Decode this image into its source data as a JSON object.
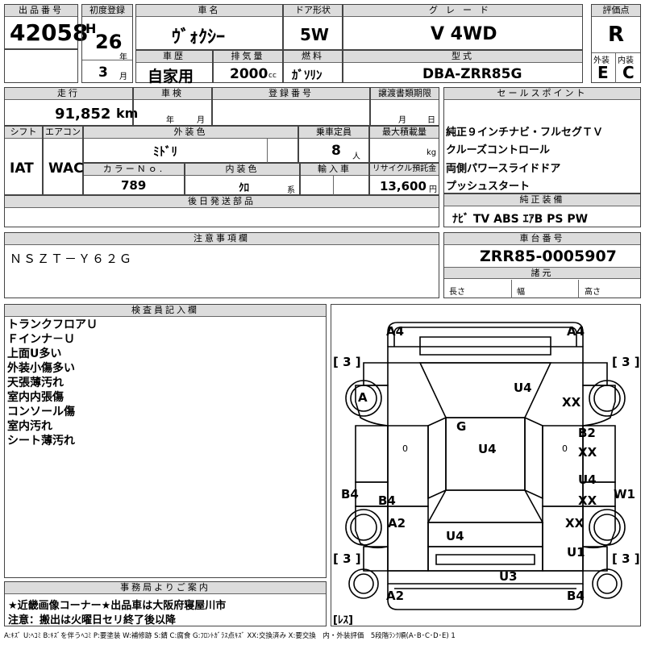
{
  "lot": {
    "label": "出品番号",
    "value": "42058"
  },
  "first_reg": {
    "label": "初度登録",
    "era": "H",
    "year": "26",
    "year_unit": "年",
    "month": "3",
    "month_unit": "月"
  },
  "car_name": {
    "label": "車名",
    "value": "ｳﾞｫｸｼｰ"
  },
  "door": {
    "label": "ドア形状",
    "value": "5W"
  },
  "grade": {
    "label": "グレード",
    "value": "V 4WD"
  },
  "score": {
    "label": "評価点",
    "value": "R",
    "ext_label": "外装",
    "int_label": "内装",
    "ext_value": "E",
    "int_value": "C"
  },
  "history": {
    "label": "車歴",
    "value": "自家用"
  },
  "displacement": {
    "label": "排気量",
    "value": "2000",
    "unit": "cc"
  },
  "fuel": {
    "label": "燃料",
    "value": "ｶﾞｿﾘﾝ"
  },
  "model": {
    "label": "型式",
    "value": "DBA-ZRR85G"
  },
  "mileage": {
    "label": "走行",
    "value": "91,852",
    "unit": "km"
  },
  "inspection": {
    "label": "車検",
    "year_unit": "年",
    "month_unit": "月"
  },
  "registration": {
    "label": "登録番号"
  },
  "transfer": {
    "label": "譲渡書類期限",
    "month_unit": "月",
    "day_unit": "日"
  },
  "shift": {
    "label": "シフト",
    "value": "IAT"
  },
  "ac": {
    "label": "エアコン",
    "value": "WAC"
  },
  "ext_color": {
    "label": "外装色",
    "value": "ﾐﾄﾞﾘ"
  },
  "capacity": {
    "label": "乗車定員",
    "value": "8",
    "unit": "人"
  },
  "max_load": {
    "label": "最大積載量",
    "unit": "kg"
  },
  "color_no": {
    "label": "カラーＮｏ.",
    "value": "789"
  },
  "int_color": {
    "label": "内装色",
    "value": "ｸﾛ",
    "unit": "系"
  },
  "import": {
    "label": "輸入車"
  },
  "recycle": {
    "label": "リサイクル預託金",
    "value": "13,600",
    "unit": "円"
  },
  "later_parts": {
    "label": "後日発送部品"
  },
  "sales_points": {
    "label": "セールスポイント",
    "items": [
      "純正９インチナビ・フルセグＴＶ",
      "クルーズコントロール",
      "両側パワースライドドア",
      "プッシュスタート"
    ]
  },
  "equipment": {
    "label": "純正装備",
    "value": "ﾅﾋﾞ TV ABS ｴｱB PS PW"
  },
  "caution": {
    "label": "注意事項欄",
    "value": "ＮＳＺＴ－Ｙ６２Ｇ"
  },
  "chassis": {
    "label": "車台番号",
    "value": "ZRR85-0005907"
  },
  "specs": {
    "label": "諸元",
    "length": "長さ",
    "width": "幅",
    "height": "高さ"
  },
  "inspector": {
    "label": "検査員記入欄",
    "lines": [
      "トランクフロアＵ",
      "Ｆインナ－Ｕ",
      "上面U多い",
      "外装小傷多い",
      "天張薄汚れ",
      "室内内張傷",
      "コンソール傷",
      "室内汚れ",
      "シート薄汚れ"
    ]
  },
  "office": {
    "label": "事務局よりご案内",
    "line1": "★近畿画像コーナー★出品車は大阪府寝屋川市",
    "line2": "注意：搬出は火曜日セリ終了後以降"
  },
  "legend": "A:ｷｽﾞ U:ﾍｺﾐ B:ｷｽﾞを伴うﾍｺﾐ P:要塗装 W:補修跡 S:錆 C:腐食 G:ﾌﾛﾝﾄｶﾞﾗｽ点ｷｽﾞ XX:交換済み X:要交換　内・外装評価　5段階ﾗﾝｸ順(A･B･C･D･E) 1",
  "diagram": {
    "marks": [
      "A4",
      "A4",
      "[ 3 ]",
      "[ 3 ]",
      "A",
      "U4",
      "XX",
      "G",
      "U4",
      "B2",
      "XX",
      "U4",
      "XX",
      "B4",
      "W1",
      "B4",
      "A2",
      "XX",
      "U4",
      "U1",
      "[ 3 ]",
      "[ 3 ]",
      "U3",
      "A2",
      "B4",
      "[ﾚｽ]"
    ],
    "zero_a": "0",
    "zero_b": "0"
  }
}
